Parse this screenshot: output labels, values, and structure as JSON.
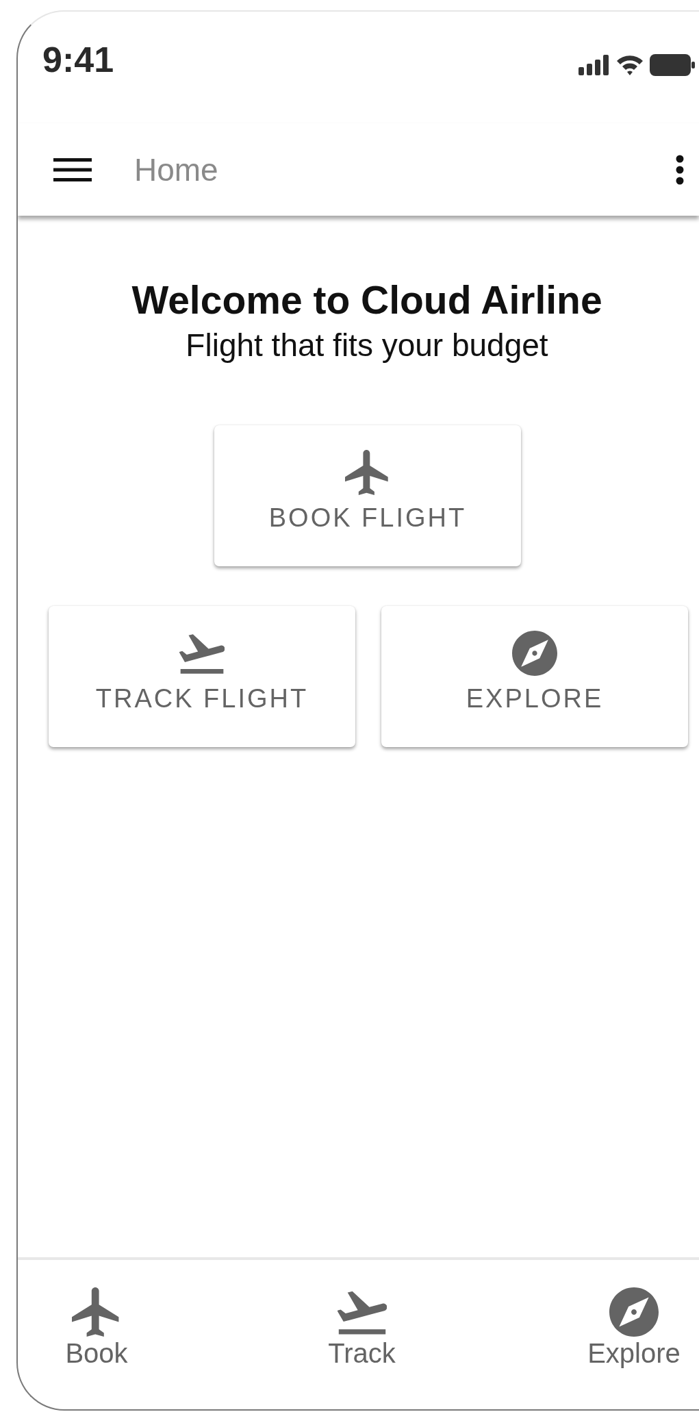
{
  "status_bar": {
    "time": "9:41"
  },
  "app_bar": {
    "title": "Home"
  },
  "welcome": {
    "title": "Welcome to Cloud Airline",
    "subtitle": "Flight that fits your budget"
  },
  "actions": [
    {
      "label": "BOOK FLIGHT",
      "kind": "plane"
    },
    {
      "label": "TRACK FLIGHT",
      "kind": "takeoff"
    },
    {
      "label": "EXPLORE",
      "kind": "compass"
    }
  ],
  "bottom_nav": [
    {
      "label": "Book",
      "kind": "plane"
    },
    {
      "label": "Track",
      "kind": "takeoff"
    },
    {
      "label": "Explore",
      "kind": "compass"
    }
  ]
}
